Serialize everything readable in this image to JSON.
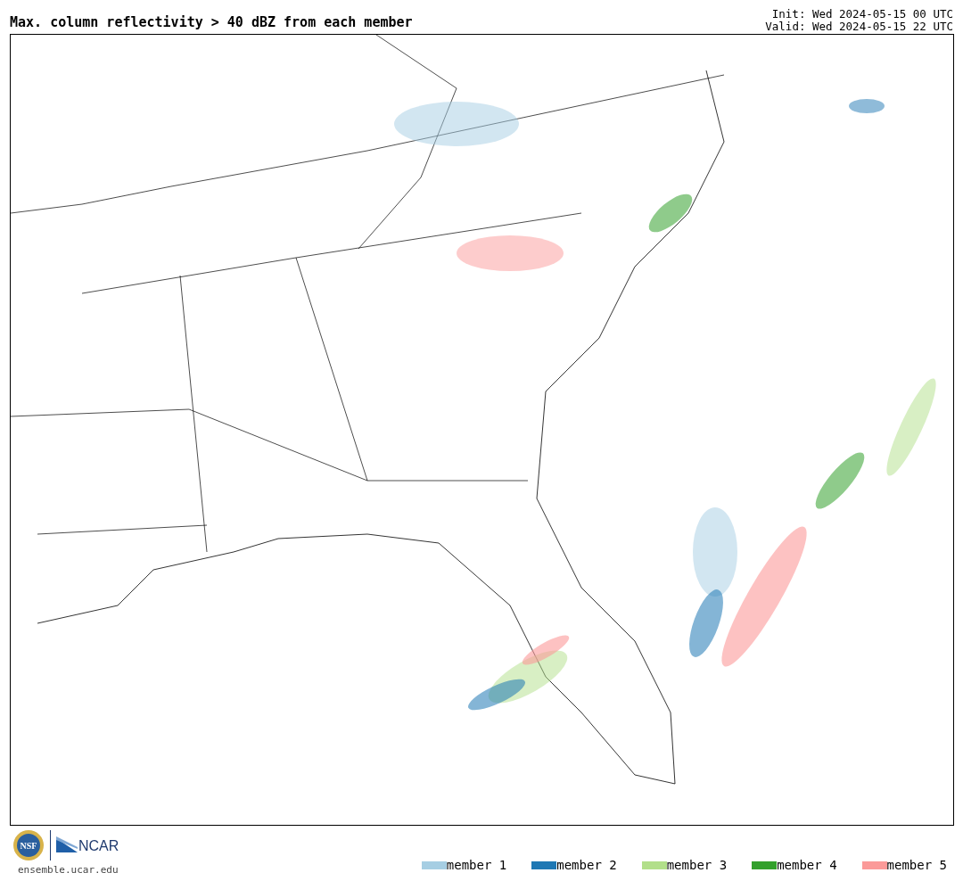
{
  "title": "Max. column reflectivity > 40 dBZ from each member",
  "init": "Init: Wed 2024-05-15 00 UTC",
  "valid": "Valid: Wed 2024-05-15 22 UTC",
  "logos": {
    "nsf": "NSF",
    "ncar": "NCAR"
  },
  "site": "ensemble.ucar.edu",
  "legend": [
    {
      "label": "member 1",
      "color": "#a6cee3"
    },
    {
      "label": "member 2",
      "color": "#1f78b4"
    },
    {
      "label": "member 3",
      "color": "#b2df8a"
    },
    {
      "label": "member 4",
      "color": "#33a02c"
    },
    {
      "label": "member 5",
      "color": "#fb9a99"
    }
  ]
}
